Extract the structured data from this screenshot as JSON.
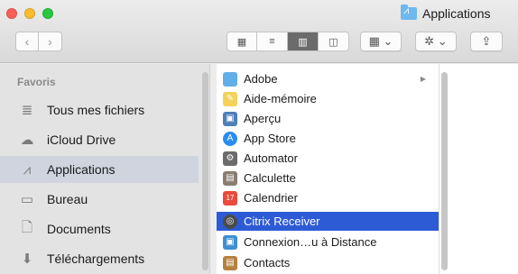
{
  "window": {
    "title": "Applications"
  },
  "toolbar": {
    "back_glyph": "‹",
    "forward_glyph": "›",
    "views": [
      {
        "name": "icon-view",
        "glyph": "▦"
      },
      {
        "name": "list-view",
        "glyph": "≡"
      },
      {
        "name": "column-view",
        "glyph": "▥"
      },
      {
        "name": "coverflow-view",
        "glyph": "◫"
      }
    ],
    "arrange_glyph": "▦ ⌄",
    "action_glyph": "✲ ⌄",
    "share_glyph": "⇪"
  },
  "sidebar": {
    "header": "Favoris",
    "items": [
      {
        "label": "Tous mes fichiers",
        "icon": "≣",
        "selected": false
      },
      {
        "label": "iCloud Drive",
        "icon": "☁",
        "selected": false
      },
      {
        "label": "Applications",
        "icon": "⩘",
        "selected": true
      },
      {
        "label": "Bureau",
        "icon": "▭",
        "selected": false
      },
      {
        "label": "Documents",
        "icon": "🗋",
        "selected": false
      },
      {
        "label": "Téléchargements",
        "icon": "⬇",
        "selected": false
      }
    ]
  },
  "files": [
    {
      "label": "Adobe",
      "icon_color": "#62aee9",
      "glyph": "",
      "folder": true,
      "selected": false
    },
    {
      "label": "Aide-mémoire",
      "icon_color": "#f3d25a",
      "glyph": "✎",
      "folder": false,
      "selected": false
    },
    {
      "label": "Aperçu",
      "icon_color": "#4d7fb8",
      "glyph": "▣",
      "folder": false,
      "selected": false
    },
    {
      "label": "App Store",
      "icon_color": "#2a8cf0",
      "glyph": "A",
      "folder": false,
      "selected": false
    },
    {
      "label": "Automator",
      "icon_color": "#6b6b6b",
      "glyph": "⚙",
      "folder": false,
      "selected": false
    },
    {
      "label": "Calculette",
      "icon_color": "#8a7d70",
      "glyph": "▤",
      "folder": false,
      "selected": false
    },
    {
      "label": "Calendrier",
      "icon_color": "#e94b3c",
      "glyph": "17",
      "folder": false,
      "selected": false
    },
    {
      "label": "Citrix Receiver",
      "icon_color": "#4b4b4b",
      "glyph": "◎",
      "folder": false,
      "selected": true
    },
    {
      "label": "Connexion…u à Distance",
      "icon_color": "#3f8fd2",
      "glyph": "▣",
      "folder": false,
      "selected": false
    },
    {
      "label": "Contacts",
      "icon_color": "#b5813f",
      "glyph": "▤",
      "folder": false,
      "selected": false
    }
  ]
}
